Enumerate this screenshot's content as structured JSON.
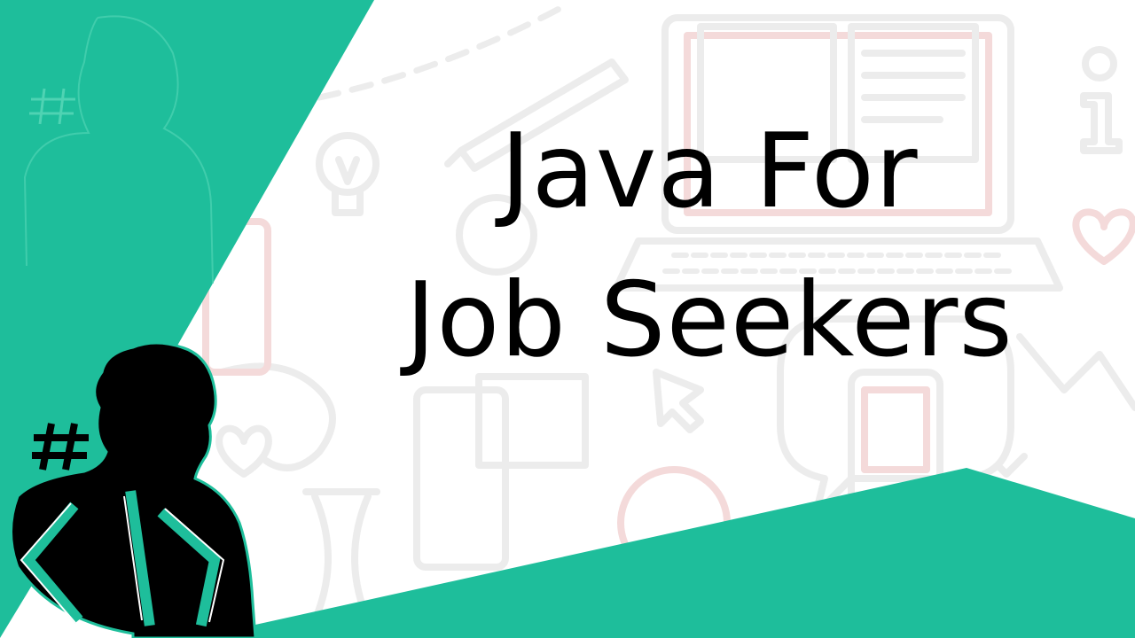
{
  "title": {
    "line1": "Java For",
    "line2": "Job Seekers"
  },
  "colors": {
    "accent": "#1ebe9b",
    "icon_outline": "#ececec",
    "icon_pink": "#f4dada",
    "text": "#000000",
    "background": "#ffffff"
  },
  "icons": [
    "hash-icon",
    "code-brackets-icon",
    "lightbulb-icon",
    "laptop-icon",
    "pen-icon",
    "info-icon",
    "heart-icon",
    "hourglass-icon",
    "book-icon",
    "magnifier-icon",
    "phone-icon",
    "person-silhouette"
  ]
}
